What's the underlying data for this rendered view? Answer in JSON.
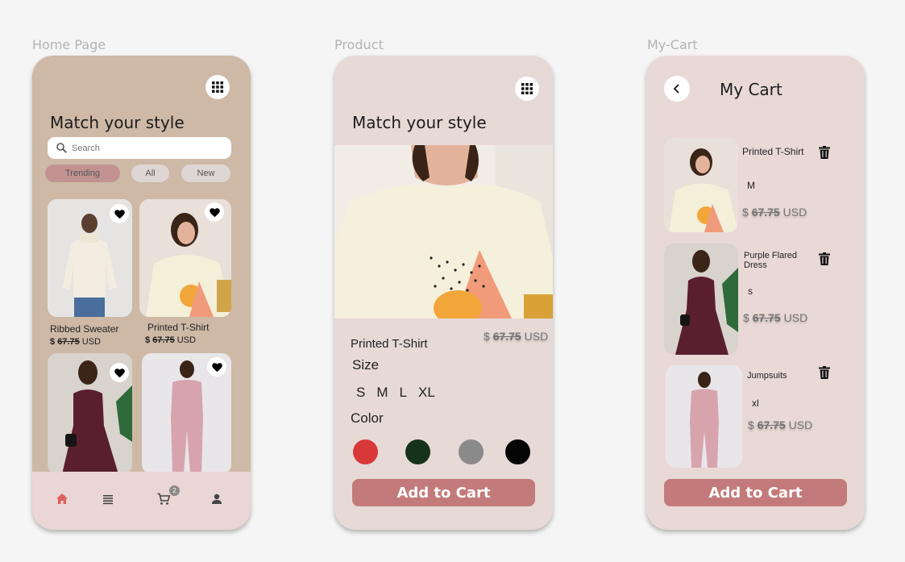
{
  "colors": {
    "home_bg": "#cdb9a6",
    "product_bg": "#e6d9d6",
    "cart_bg": "#e9d9d6",
    "accent": "#c27b7a",
    "trending_chip": "#c29291"
  },
  "labels": {
    "home": "Home Page",
    "product": "Product",
    "cart": "My-Cart"
  },
  "home": {
    "title": "Match your style",
    "search_placeholder": "Search",
    "chips": [
      "Trending",
      "All",
      "New"
    ],
    "products": [
      {
        "name": "Ribbed Sweater",
        "price_prefix": "$",
        "price": "67.75",
        "currency": "USD"
      },
      {
        "name": "Printed T-Shirt",
        "price_prefix": "$",
        "price": "67.75",
        "currency": "USD"
      }
    ],
    "cart_badge": "2"
  },
  "product": {
    "title": "Match your style",
    "name": "Printed T-Shirt",
    "price_prefix": "$",
    "price": "67.75",
    "currency": "USD",
    "size_label": "Size",
    "sizes": [
      "S",
      "M",
      "L",
      "XL"
    ],
    "color_label": "Color",
    "colors": [
      "#d9383a",
      "#17321b",
      "#8a8a8a",
      "#050505"
    ],
    "add_to_cart": "Add to Cart"
  },
  "cart": {
    "title": "My Cart",
    "items": [
      {
        "name": "Printed T-Shirt",
        "size": "M",
        "price_prefix": "$",
        "price": "67.75",
        "currency": "USD"
      },
      {
        "name": "Purple Flared Dress",
        "size": "s",
        "price_prefix": "$",
        "price": "67.75",
        "currency": "USD"
      },
      {
        "name": "Jumpsuits",
        "size": "xl",
        "price_prefix": "$",
        "price": "67.75",
        "currency": "USD"
      }
    ],
    "add_to_cart": "Add to Cart"
  },
  "icons": [
    "grid-icon",
    "search-icon",
    "heart-icon",
    "home-icon",
    "menu-icon",
    "cart-icon",
    "user-icon",
    "back-icon",
    "trash-icon"
  ]
}
